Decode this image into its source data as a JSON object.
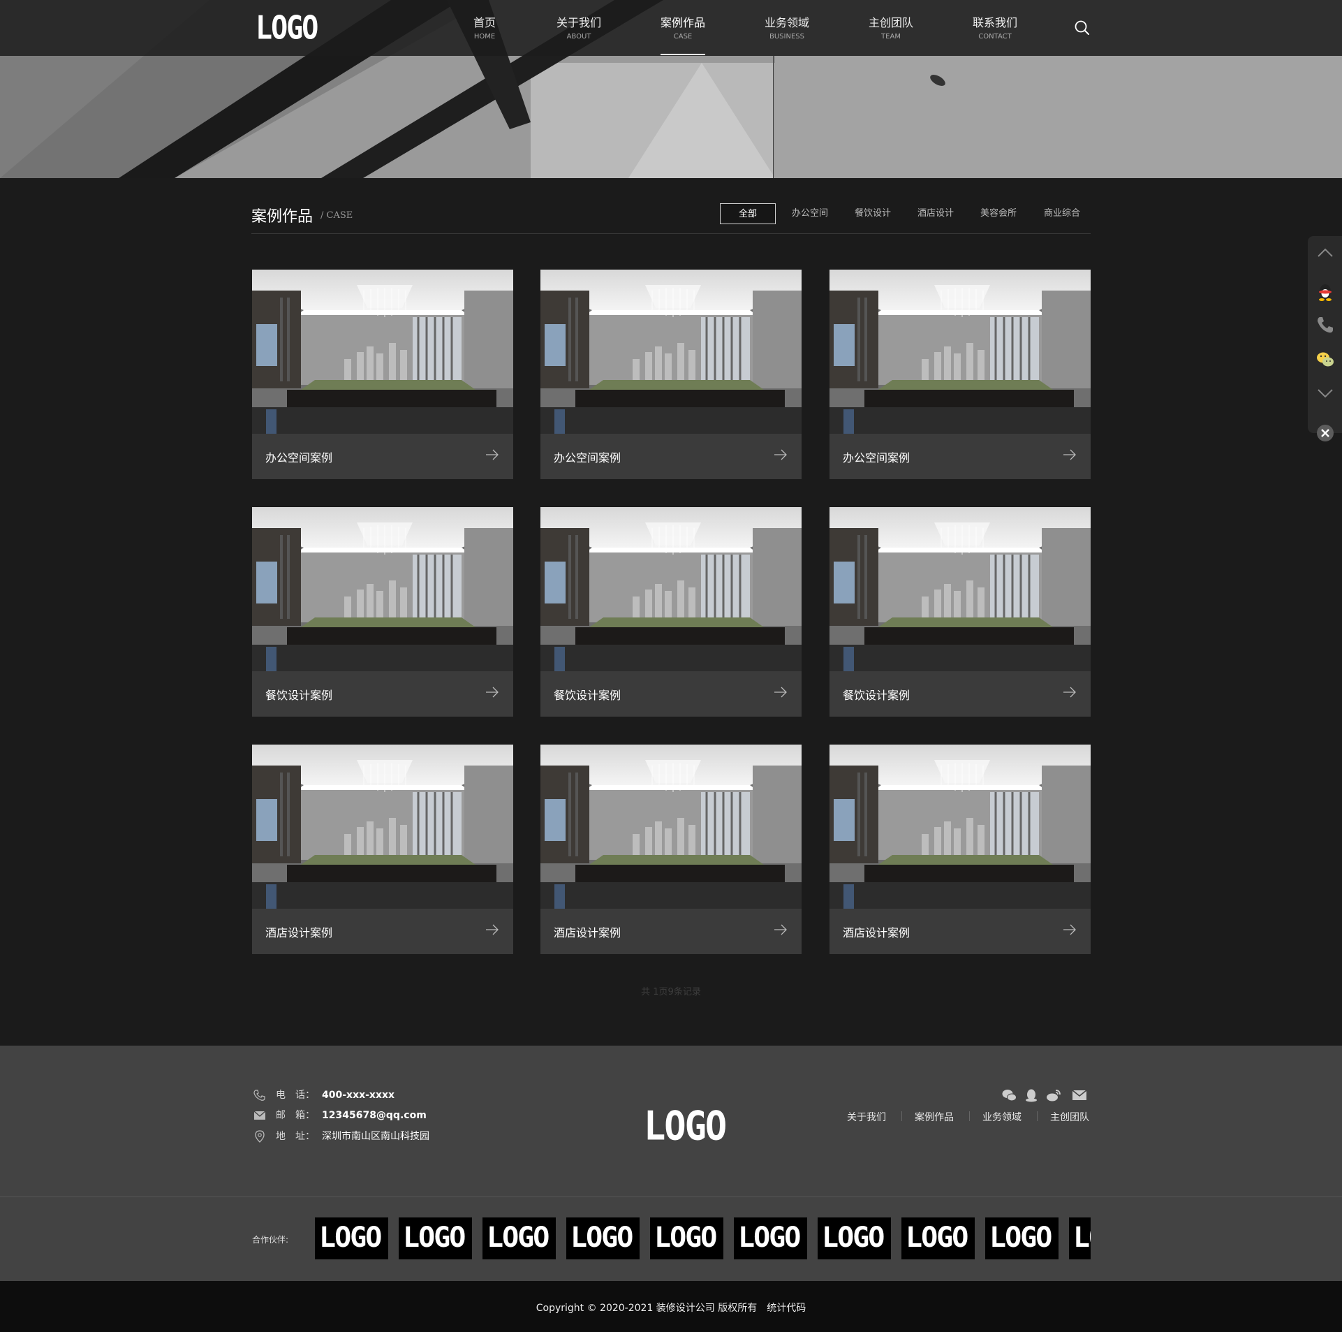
{
  "header": {
    "logo": "LOGO",
    "nav": [
      {
        "zh": "首页",
        "en": "HOME"
      },
      {
        "zh": "关于我们",
        "en": "ABOUT"
      },
      {
        "zh": "案例作品",
        "en": "CASE"
      },
      {
        "zh": "业务领域",
        "en": "BUSINESS"
      },
      {
        "zh": "主创团队",
        "en": "TEAM"
      },
      {
        "zh": "联系我们",
        "en": "CONTACT"
      }
    ],
    "active_index": 2,
    "search_icon": "search-icon"
  },
  "case_section": {
    "title": "案例作品",
    "subtitle": "/ CASE",
    "filters": [
      "全部",
      "办公空间",
      "餐饮设计",
      "酒店设计",
      "美容会所",
      "商业综合"
    ],
    "active_filter": 0,
    "cards": [
      {
        "caption": "办公空间案例"
      },
      {
        "caption": "办公空间案例"
      },
      {
        "caption": "办公空间案例"
      },
      {
        "caption": "餐饮设计案例"
      },
      {
        "caption": "餐饮设计案例"
      },
      {
        "caption": "餐饮设计案例"
      },
      {
        "caption": "酒店设计案例"
      },
      {
        "caption": "酒店设计案例"
      },
      {
        "caption": "酒店设计案例"
      }
    ],
    "pager": "共 1页9条记录"
  },
  "side_float": {
    "icons": [
      "chevron-up-icon",
      "qq-icon",
      "phone-icon",
      "wechat-icon",
      "chevron-down-icon",
      "close-icon"
    ]
  },
  "footer": {
    "phone_label": "电　话：",
    "phone": "400-xxx-xxxx",
    "email_label": "邮　箱：",
    "email": "12345678@qq.com",
    "address_label": "地　址：",
    "address": "深圳市南山区南山科技园",
    "logo": "LOGO",
    "links": [
      "关于我们",
      "案例作品",
      "业务领域",
      "主创团队"
    ],
    "social_icons": [
      "wechat-icon",
      "qq-icon",
      "weibo-icon",
      "mail-icon"
    ]
  },
  "partners": {
    "label": "合作伙伴:",
    "logos": [
      "LOGO",
      "LOGO",
      "LOGO",
      "LOGO",
      "LOGO",
      "LOGO",
      "LOGO",
      "LOGO",
      "LOGO",
      "LOGO"
    ]
  },
  "copyright": "Copyright © 2020-2021 装修设计公司 版权所有　统计代码",
  "colors": {
    "page_bg": "#1b1b1b",
    "card_bg": "#3b3b3b",
    "footer_bg": "#434343",
    "copyright_bg": "#0d0d0d",
    "accent": "#ffffff"
  }
}
